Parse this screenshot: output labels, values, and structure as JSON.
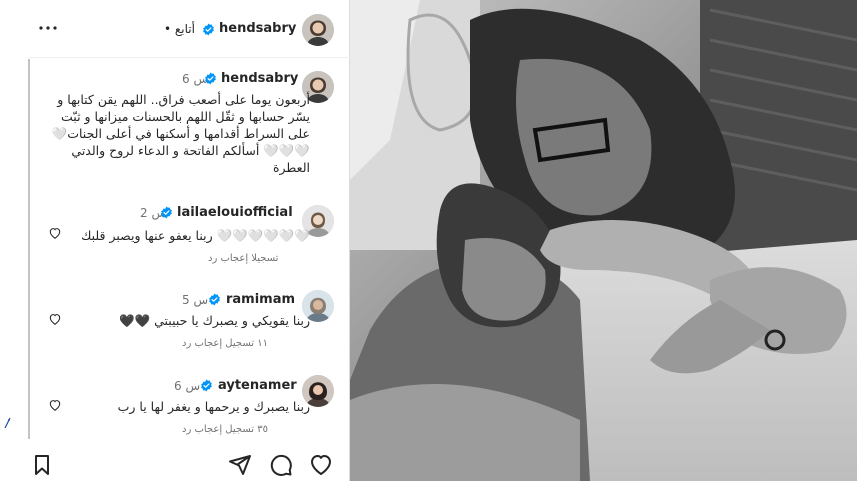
{
  "post": {
    "author": "hendsabry",
    "follow_label": "• أتابع"
  },
  "caption": {
    "username": "hendsabry",
    "time": "6 س",
    "text": "أربعون يوما على أصعب فراق.. اللهم يقن كتابها و يسّر حسابها و ثقّل اللهم بالحسنات ميزانها  و ثبّت على السراط أقدامها و أسكنها في أعلى الجنات🤍🤍🤍🤍 أسألكم الفاتحة و الدعاء لروح والدتي العطرة"
  },
  "comments": [
    {
      "username": "lailaelouiofficial",
      "time": "2 س",
      "text": "🤍🤍🤍🤍🤍🤍 ربنا يعفو عنها ويصبر قلبك",
      "meta": "تسجيلا إعجاب    رد"
    },
    {
      "username": "ramimam",
      "time": "5 س",
      "text": "ربنا يقويكي و يصبرك يا حبيبتي 🖤🖤",
      "meta": "١١ تسجيل إعجاب    رد"
    },
    {
      "username": "aytenamer",
      "time": "6 س",
      "text": "ربنا يصبرك و يرحمها و يغفر لها يا رب",
      "meta": "٣٥ تسجيل إعجاب    رد"
    }
  ],
  "icons": {
    "header_more": "more-horizontal-icon",
    "verified": "verified-badge-icon",
    "comment_like": "heart-outline-icon",
    "like": "heart-icon",
    "comment": "comment-icon",
    "share": "send-icon",
    "save": "bookmark-icon"
  },
  "colors": {
    "verified": "#0095f6",
    "text": "#262626",
    "secondary": "#737373",
    "divider": "#dbdbdb"
  }
}
